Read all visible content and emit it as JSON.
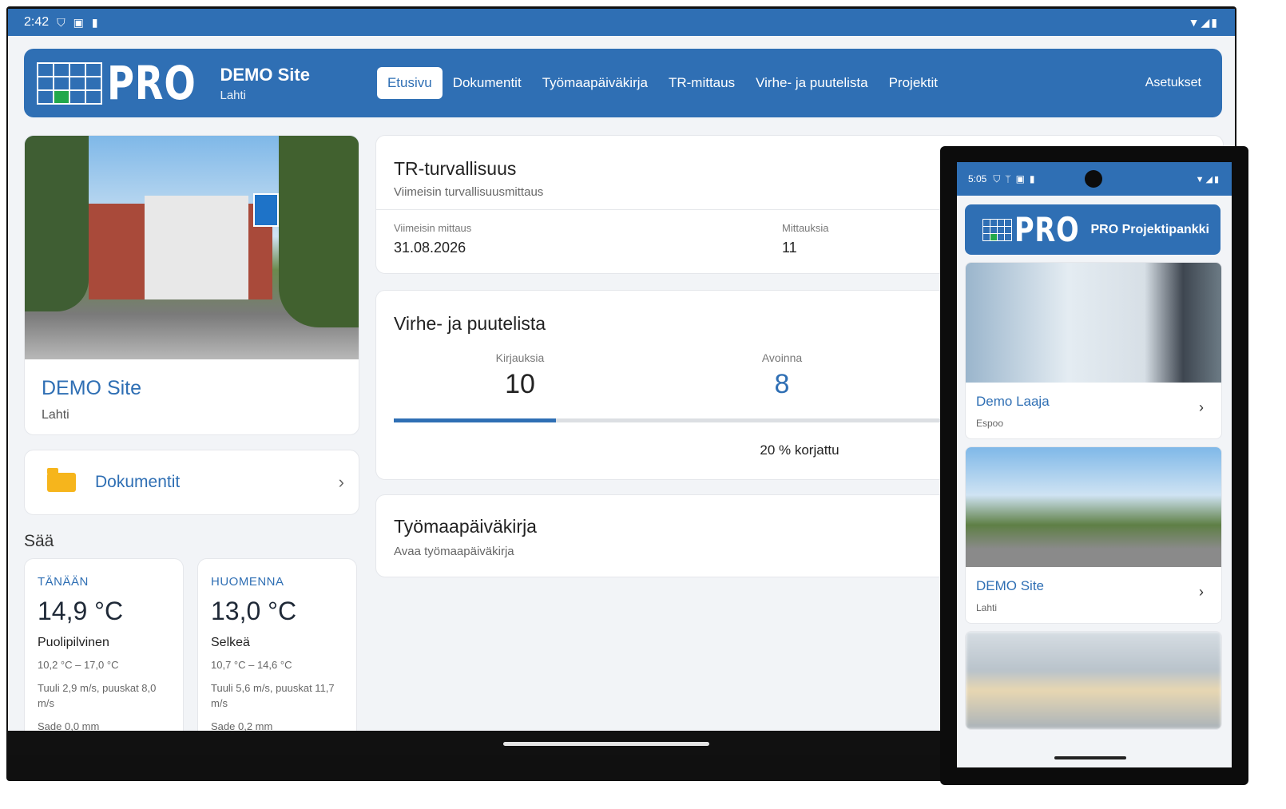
{
  "tablet": {
    "status": {
      "time": "2:42",
      "icons": [
        "shield-icon",
        "a-icon",
        "sd-card-icon"
      ],
      "right_icons": [
        "wifi-icon",
        "signal-icon",
        "battery-icon"
      ]
    },
    "navbar": {
      "logo_text": "PRO",
      "site_name": "DEMO Site",
      "site_location": "Lahti",
      "links": [
        "Etusivu",
        "Dokumentit",
        "Työmaapäiväkirja",
        "TR-mittaus",
        "Virhe- ja puutelista",
        "Projektit"
      ],
      "active_link": "Etusivu",
      "settings": "Asetukset"
    },
    "site_card": {
      "title": "DEMO Site",
      "location": "Lahti"
    },
    "documents": {
      "label": "Dokumentit",
      "chevron": "›"
    },
    "weather": {
      "heading": "Sää",
      "today": {
        "day": "TÄNÄÄN",
        "temp": "14,9 °C",
        "desc": "Puolipilvinen",
        "range": "10,2 °C – 17,0 °C",
        "wind": "Tuuli 2,9 m/s, puuskat 8,0 m/s",
        "rain": "Sade 0,0 mm"
      },
      "tomorrow": {
        "day": "HUOMENNA",
        "temp": "13,0 °C",
        "desc": "Selkeä",
        "range": "10,7 °C – 14,6 °C",
        "wind": "Tuuli 5,6 m/s, puuskat 11,7 m/s",
        "rain": "Sade 0,2 mm"
      }
    },
    "tr": {
      "title": "TR-turvallisuus",
      "subtitle": "Viimeisin turvallisuusmittaus",
      "latest_label": "Viimeisin mittaus",
      "latest_value": "31.08.2026",
      "count_label": "Mittauksia",
      "count_value": "11"
    },
    "vp": {
      "title": "Virhe- ja puutelista",
      "entries_label": "Kirjauksia",
      "entries_value": "10",
      "open_label": "Avoinna",
      "open_value": "8",
      "fixed_fraction": 0.2,
      "fixed_text": "20 % korjattu"
    },
    "diary": {
      "title": "Työmaapäiväkirja",
      "subtitle": "Avaa työmaapäiväkirja"
    },
    "accent": "#2f6fb4"
  },
  "phone": {
    "status": {
      "time": "5:05",
      "icons": [
        "shield-icon",
        "usb-icon",
        "a-icon",
        "sd-card-icon"
      ],
      "right_icons": [
        "wifi-icon",
        "signal-icon",
        "battery-icon"
      ]
    },
    "header": {
      "logo_text": "PRO",
      "title": "PRO Projektipankki"
    },
    "projects": [
      {
        "name": "Demo Laaja",
        "location": "Espoo"
      },
      {
        "name": "DEMO Site",
        "location": "Lahti"
      }
    ],
    "chevron": "›"
  }
}
